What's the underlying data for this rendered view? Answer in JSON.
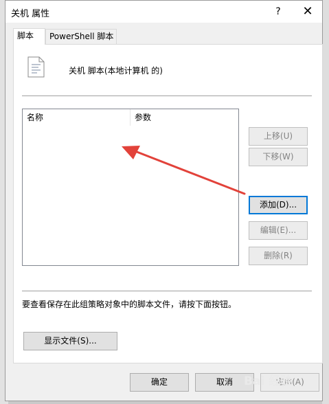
{
  "window": {
    "title": "关机 属性",
    "help_label": "?",
    "close_label": "✕"
  },
  "tabs": [
    {
      "label": "脚本",
      "active": true
    },
    {
      "label": "PowerShell 脚本",
      "active": false
    }
  ],
  "header": {
    "label": "关机 脚本(本地计算机 的)",
    "icon": "script-file-icon"
  },
  "list": {
    "columns": [
      "名称",
      "参数"
    ],
    "rows": []
  },
  "buttons": {
    "move_up": "上移(U)",
    "move_down": "下移(W)",
    "add": "添加(D)...",
    "edit": "编辑(E)...",
    "remove": "删除(R)",
    "show_files": "显示文件(S)...",
    "ok": "确定",
    "cancel": "取消",
    "apply": "应用(A)"
  },
  "info_text": "要查看保存在此组策略对象中的脚本文件，请按下面按钮。",
  "annotation": {
    "color": "#e2423a"
  },
  "watermark": "Bai 经验"
}
